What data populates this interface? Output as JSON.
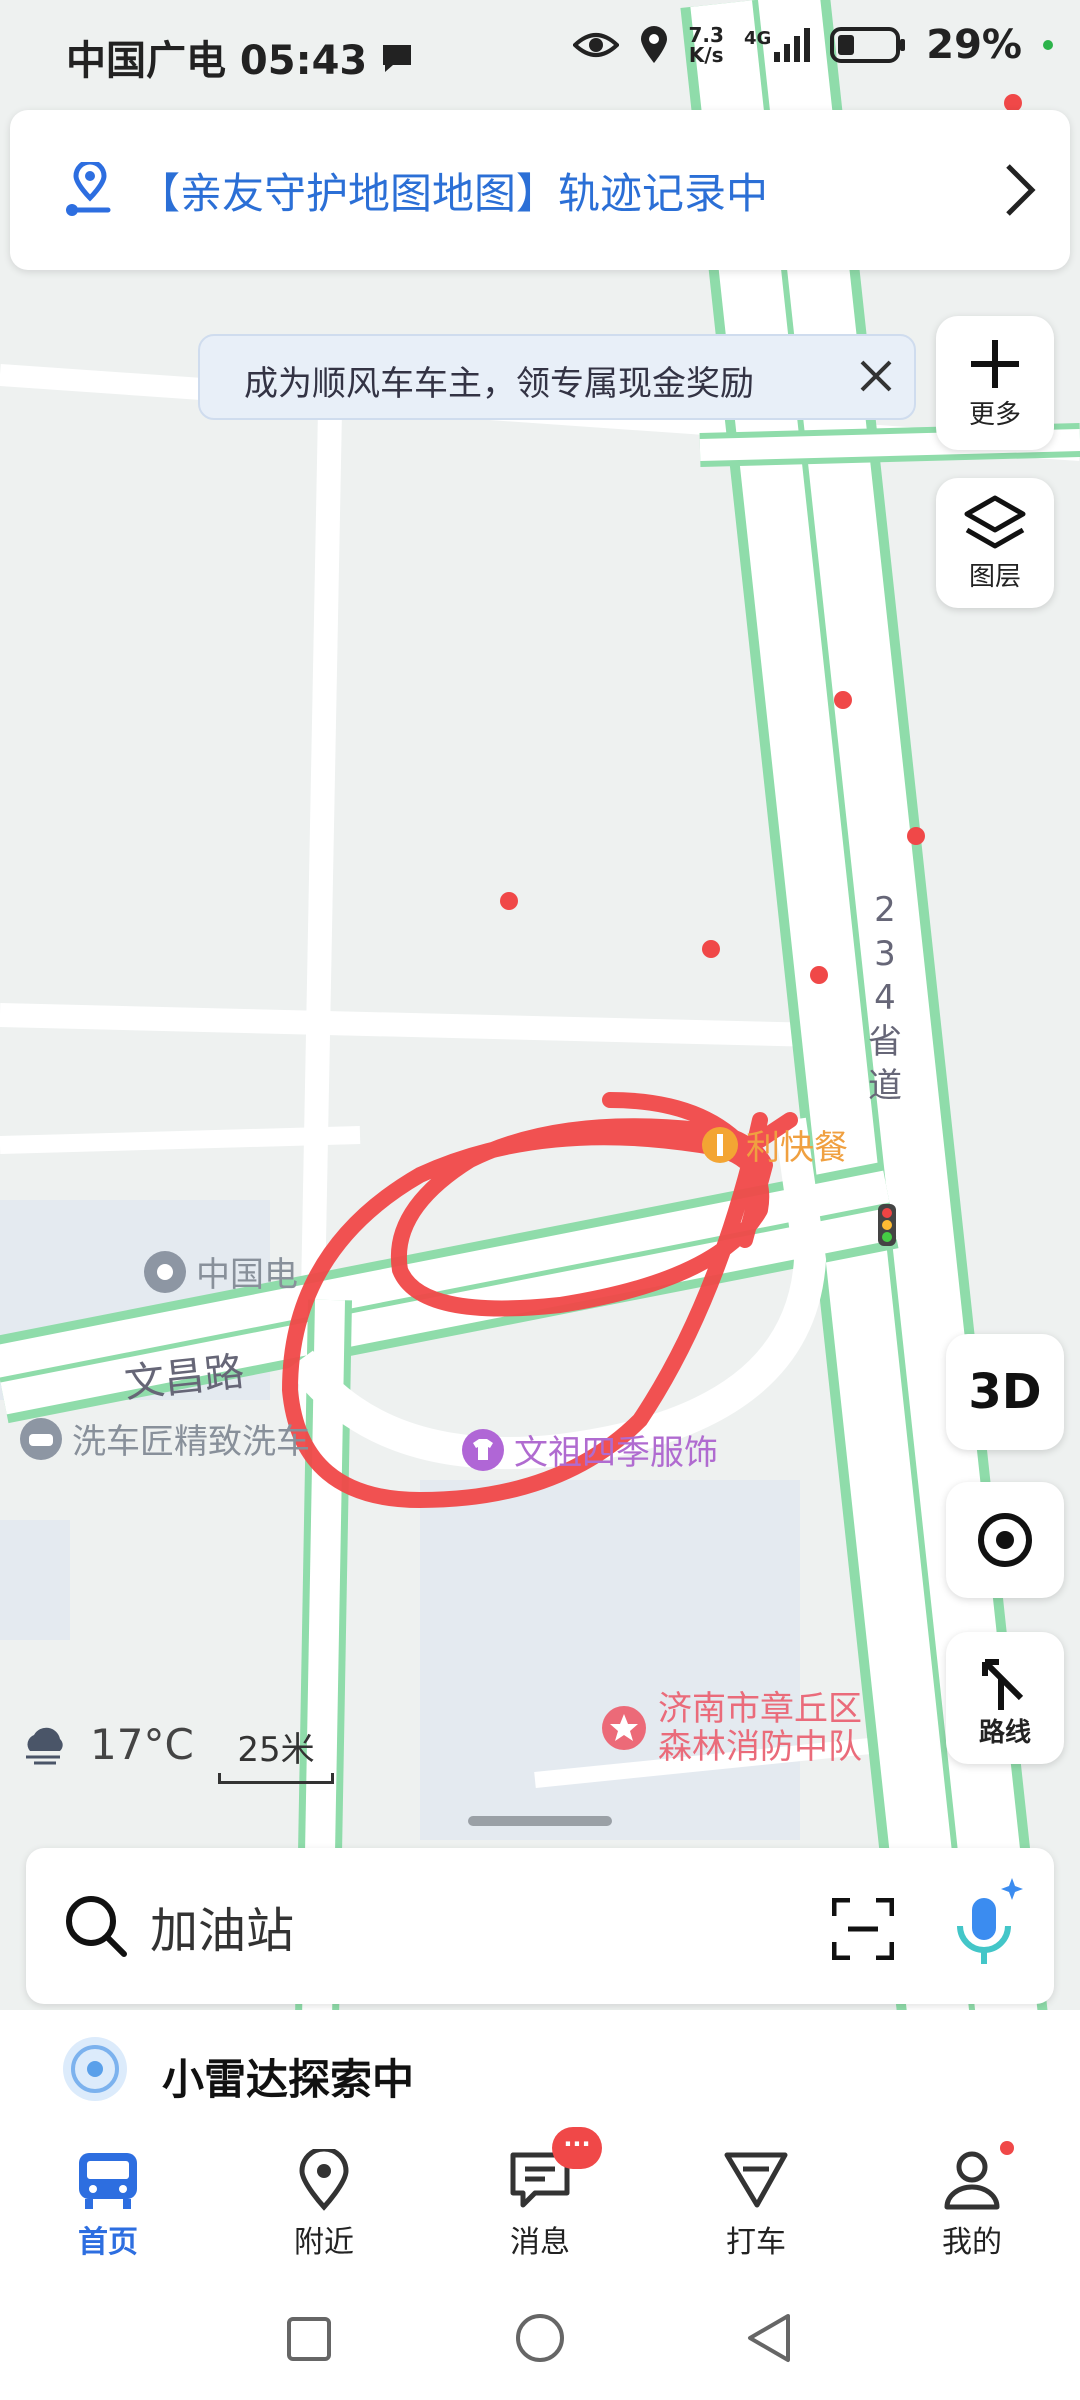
{
  "status": {
    "carrier_time": "中国广电 05:43",
    "net_speed_top": "7.3",
    "net_speed_unit": "K/s",
    "network": "4G",
    "battery": "29%"
  },
  "track_banner": {
    "text": "【亲友守护地图地图】轨迹记录中"
  },
  "promo": {
    "text": "成为顺风车车主，领专属现金奖励"
  },
  "side": {
    "more": "更多",
    "layers": "图层",
    "three_d": "3D",
    "route": "路线"
  },
  "map_labels": {
    "road_234_1": "2",
    "road_234_2": "3",
    "road_234_3": "4",
    "road_234_4": "省",
    "road_234_5": "道",
    "wenchang": "文昌路",
    "china_tel": "中国电",
    "carwash": "洗车匠精致洗车",
    "wenzu": "文祖四季服饰",
    "fastfood": "利快餐",
    "fire_1": "济南市章丘区",
    "fire_2": "森林消防中队"
  },
  "weather": {
    "temp": "17°C"
  },
  "scale": {
    "label": "25米"
  },
  "search": {
    "placeholder": "加油站"
  },
  "radar": {
    "text": "小雷达探索中"
  },
  "tabs": [
    {
      "label": "首页"
    },
    {
      "label": "附近"
    },
    {
      "label": "消息",
      "badge": "···"
    },
    {
      "label": "打车"
    },
    {
      "label": "我的"
    }
  ],
  "colors": {
    "accent": "#2d6ee0",
    "road_edge": "#8fdcaa",
    "annotation": "#f05050"
  }
}
